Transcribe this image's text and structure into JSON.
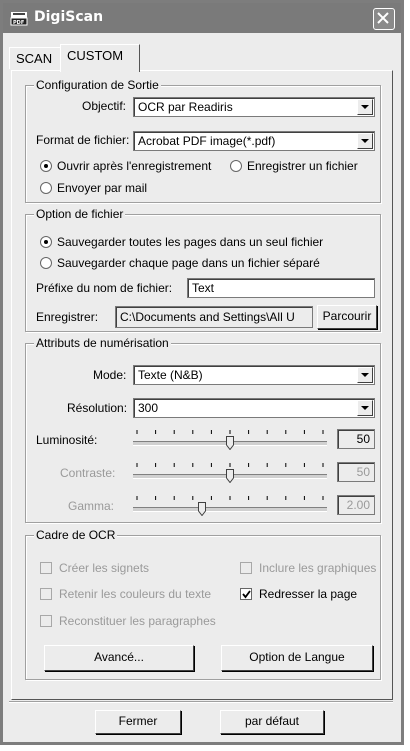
{
  "window": {
    "title": "DigiScan"
  },
  "tabs": [
    {
      "label": "SCAN"
    },
    {
      "label": "CUSTOM"
    }
  ],
  "config": {
    "legend": "Configuration de Sortie",
    "objectif_label": "Objectif:",
    "objectif_value": "OCR par Readiris",
    "format_label": "Format de fichier:",
    "format_value": "Acrobat PDF image(*.pdf)",
    "radio_open": "Ouvrir après l'enregistrement",
    "radio_save": "Enregistrer un fichier",
    "radio_mail": "Envoyer par mail"
  },
  "file_option": {
    "legend": "Option de fichier",
    "radio_single": "Sauvegarder toutes les pages dans un seul fichier",
    "radio_separate": "Sauvegarder chaque page dans un fichier séparé",
    "prefix_label": "Préfixe du nom de fichier:",
    "prefix_value": "Text",
    "save_label": "Enregistrer:",
    "save_path": "C:\\Documents and Settings\\All U",
    "browse_label": "Parcourir"
  },
  "scan_attrs": {
    "legend": "Attributs de numérisation",
    "mode_label": "Mode:",
    "mode_value": "Texte (N&B)",
    "res_label": "Résolution:",
    "res_value": "300",
    "brightness_label": "Luminosité:",
    "brightness_value": "50",
    "brightness_level": 0.5,
    "contrast_label": "Contraste:",
    "contrast_value": "50",
    "contrast_level": 0.5,
    "gamma_label": "Gamma:",
    "gamma_value": "2.00",
    "gamma_level": 0.35
  },
  "ocr": {
    "legend": "Cadre de OCR",
    "bookmarks": "Créer les signets",
    "graphics": "Inclure les graphiques",
    "colors": "Retenir les couleurs du texte",
    "straighten": "Redresser la page",
    "paragraphs": "Reconstituer les paragraphes",
    "advanced_btn": "Avancé...",
    "language_btn": "Option de Langue"
  },
  "footer": {
    "close_btn": "Fermer",
    "default_btn": "par défaut"
  }
}
